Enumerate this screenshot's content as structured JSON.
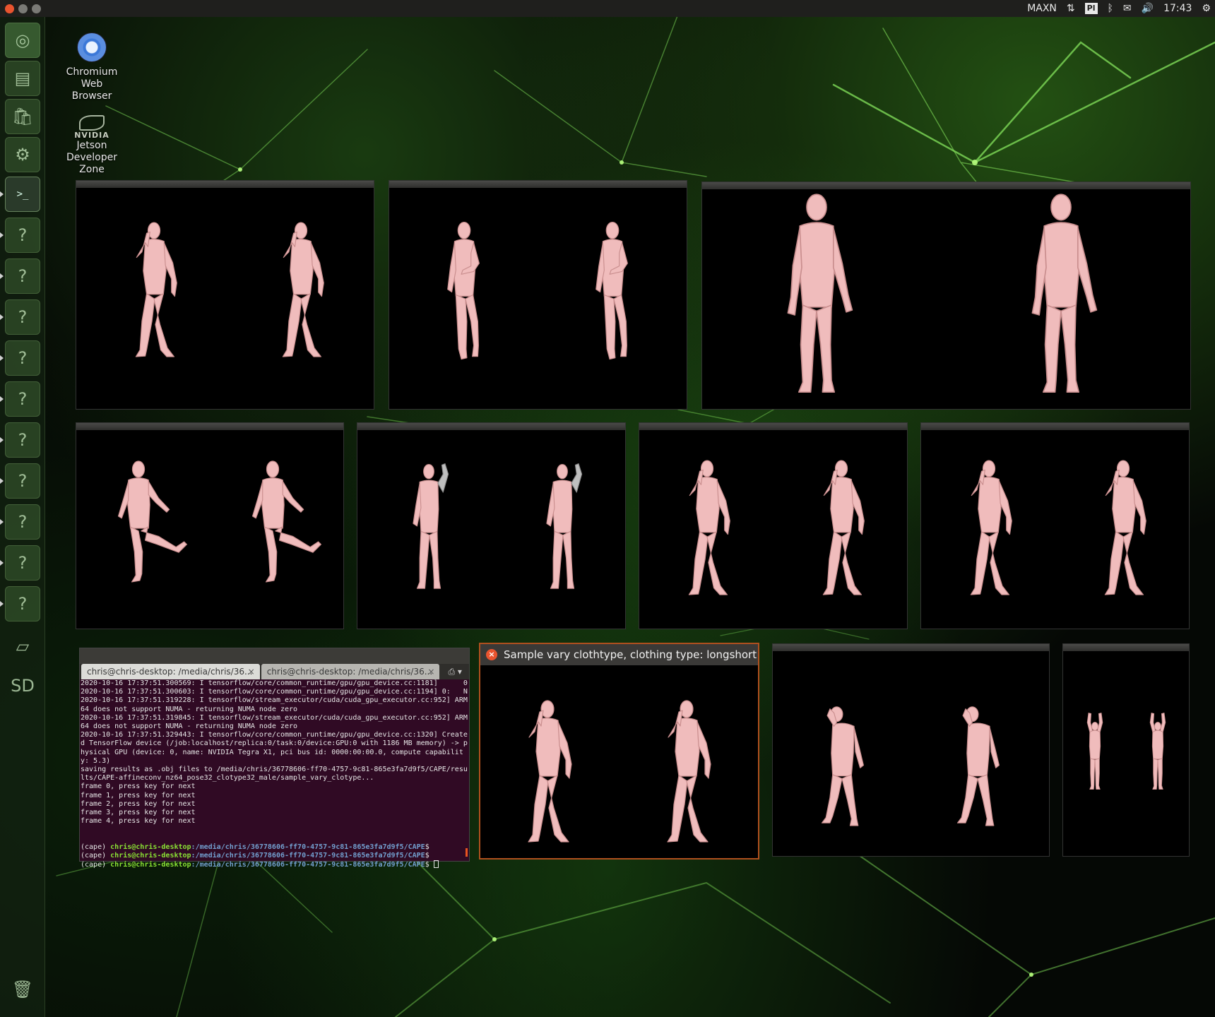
{
  "colors": {
    "panel": "#1f1f1d",
    "terminal_bg": "#300a24",
    "prompt_user": "#8ae234",
    "prompt_path": "#729fcf",
    "mesh": "#f0bcbc",
    "focus_border": "#b0501e",
    "close": "#e9542f"
  },
  "top_panel": {
    "indicators": [
      {
        "icon": "nvidia-settings-icon",
        "text": ""
      },
      {
        "icon": "nvidia-eye-icon",
        "text": ""
      },
      {
        "icon": "power-mode-label",
        "text": "MAXN"
      },
      {
        "icon": "network-arrows-icon",
        "text": "⇅"
      },
      {
        "icon": "keyboard-layout-icon",
        "text": "Pl"
      },
      {
        "icon": "bluetooth-icon",
        "text": "ᛒ"
      },
      {
        "icon": "mail-icon",
        "text": "✉"
      },
      {
        "icon": "volume-icon",
        "text": "🔊"
      },
      {
        "icon": "clock-label",
        "text": "17:43"
      },
      {
        "icon": "gear-icon",
        "text": "⚙"
      }
    ]
  },
  "launcher": {
    "items": [
      {
        "icon": "ubuntu-dash-icon",
        "glyph": "◎"
      },
      {
        "icon": "files-icon",
        "glyph": "▤"
      },
      {
        "icon": "software-store-icon",
        "glyph": "🛍"
      },
      {
        "icon": "settings-icon",
        "glyph": "⚙"
      },
      {
        "icon": "terminal-icon",
        "glyph": ">_"
      },
      {
        "icon": "unknown-app-icon",
        "glyph": "?"
      },
      {
        "icon": "unknown-app-icon",
        "glyph": "?"
      },
      {
        "icon": "unknown-app-icon",
        "glyph": "?"
      },
      {
        "icon": "unknown-app-icon",
        "glyph": "?"
      },
      {
        "icon": "unknown-app-icon",
        "glyph": "?"
      },
      {
        "icon": "unknown-app-icon",
        "glyph": "?"
      },
      {
        "icon": "unknown-app-icon",
        "glyph": "?"
      },
      {
        "icon": "unknown-app-icon",
        "glyph": "?"
      },
      {
        "icon": "unknown-app-icon",
        "glyph": "?"
      },
      {
        "icon": "unknown-app-icon",
        "glyph": "?"
      },
      {
        "icon": "drive-icon",
        "glyph": "▱"
      },
      {
        "icon": "sd-card-icon",
        "glyph": "SD"
      },
      {
        "icon": "trash-icon",
        "glyph": "🗑"
      }
    ]
  },
  "desktop": {
    "icons": [
      {
        "name": "chromium-launcher",
        "label_lines": [
          "Chromium",
          "Web",
          "Browser"
        ]
      },
      {
        "name": "jetson-zone-launcher",
        "brand": "NVIDIA",
        "label_lines": [
          "Jetson",
          "Developer",
          "Zone"
        ]
      }
    ]
  },
  "sample_window": {
    "title": "Sample vary clothtype, clothing type: longshort"
  },
  "terminal": {
    "tabs": [
      {
        "label": "chris@chris-desktop: /media/chris/36..."
      },
      {
        "label": "chris@chris-desktop: /media/chris/36..."
      }
    ],
    "output_lines": [
      "2020-10-16 17:37:51.300569: I tensorflow/core/common_runtime/gpu/gpu_device.cc:1181]      0",
      "2020-10-16 17:37:51.300603: I tensorflow/core/common_runtime/gpu/gpu_device.cc:1194] 0:   N",
      "2020-10-16 17:37:51.319228: I tensorflow/stream_executor/cuda/cuda_gpu_executor.cc:952] ARM64 does not support NUMA - returning NUMA node zero",
      "2020-10-16 17:37:51.319845: I tensorflow/stream_executor/cuda/cuda_gpu_executor.cc:952] ARM64 does not support NUMA - returning NUMA node zero",
      "2020-10-16 17:37:51.329443: I tensorflow/core/common_runtime/gpu/gpu_device.cc:1320] Created TensorFlow device (/job:localhost/replica:0/task:0/device:GPU:0 with 1186 MB memory) -> physical GPU (device: 0, name: NVIDIA Tegra X1, pci bus id: 0000:00:00.0, compute capability: 5.3)",
      "saving results as .obj files to /media/chris/36778606-ff70-4757-9c81-865e3fa7d9f5/CAPE/results/CAPE-affineconv_nz64_pose32_clotype32_male/sample_vary_clotype...",
      "frame 0, press key for next",
      "frame 1, press key for next",
      "frame 2, press key for next",
      "frame 3, press key for next",
      "frame 4, press key for next",
      "",
      ""
    ],
    "prompt_env": "(cape) ",
    "prompt_user": "chris@chris-desktop",
    "prompt_path": ":/media/chris/36778606-ff70-4757-9c81-865e3fa7d9f5/CAPE",
    "prompt_symbol": "$",
    "prompt_count": 3
  }
}
